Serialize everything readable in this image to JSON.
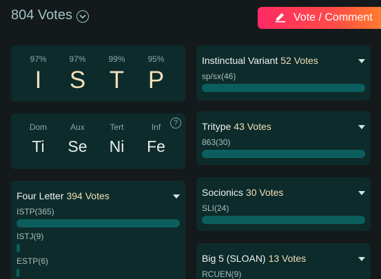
{
  "header": {
    "vote_total": "804 Votes",
    "vote_button_label": "Vote / Comment"
  },
  "type_letters": [
    {
      "pct": "97%",
      "letter": "I"
    },
    {
      "pct": "97%",
      "letter": "S"
    },
    {
      "pct": "99%",
      "letter": "T"
    },
    {
      "pct": "95%",
      "letter": "P"
    }
  ],
  "functions": [
    {
      "label": "Dom",
      "value": "Ti"
    },
    {
      "label": "Aux",
      "value": "Se"
    },
    {
      "label": "Tert",
      "value": "Ni"
    },
    {
      "label": "Inf",
      "value": "Fe"
    }
  ],
  "help_symbol": "?",
  "polls": {
    "four_letter": {
      "title": "Four Letter",
      "votes": "394 Votes",
      "options": [
        {
          "label": "ISTP(365)",
          "fraction": 1.0
        },
        {
          "label": "ISTJ(9)",
          "fraction": 0.02
        },
        {
          "label": "ESTP(6)",
          "fraction": 0.015
        }
      ]
    },
    "instinctual": {
      "title": "Instinctual Variant",
      "votes": "52 Votes",
      "options": [
        {
          "label": "sp/sx(46)",
          "fraction": 1.0
        }
      ]
    },
    "tritype": {
      "title": "Tritype",
      "votes": "43 Votes",
      "options": [
        {
          "label": "863(30)",
          "fraction": 1.0
        }
      ]
    },
    "socionics": {
      "title": "Socionics",
      "votes": "30 Votes",
      "options": [
        {
          "label": "SLI(24)",
          "fraction": 1.0
        }
      ]
    },
    "big5": {
      "title": "Big 5 (SLOAN)",
      "votes": "13 Votes",
      "options": [
        {
          "label": "RCUEN(9)",
          "fraction": 1.0
        }
      ]
    }
  },
  "colors": {
    "background": "#141a1c",
    "card": "#0d2b2a",
    "accent_letters": "#f3dfbb",
    "bar": "#0c5e5e",
    "button_gradient_start": "#ff2a63",
    "button_gradient_end": "#ff7b2c"
  }
}
